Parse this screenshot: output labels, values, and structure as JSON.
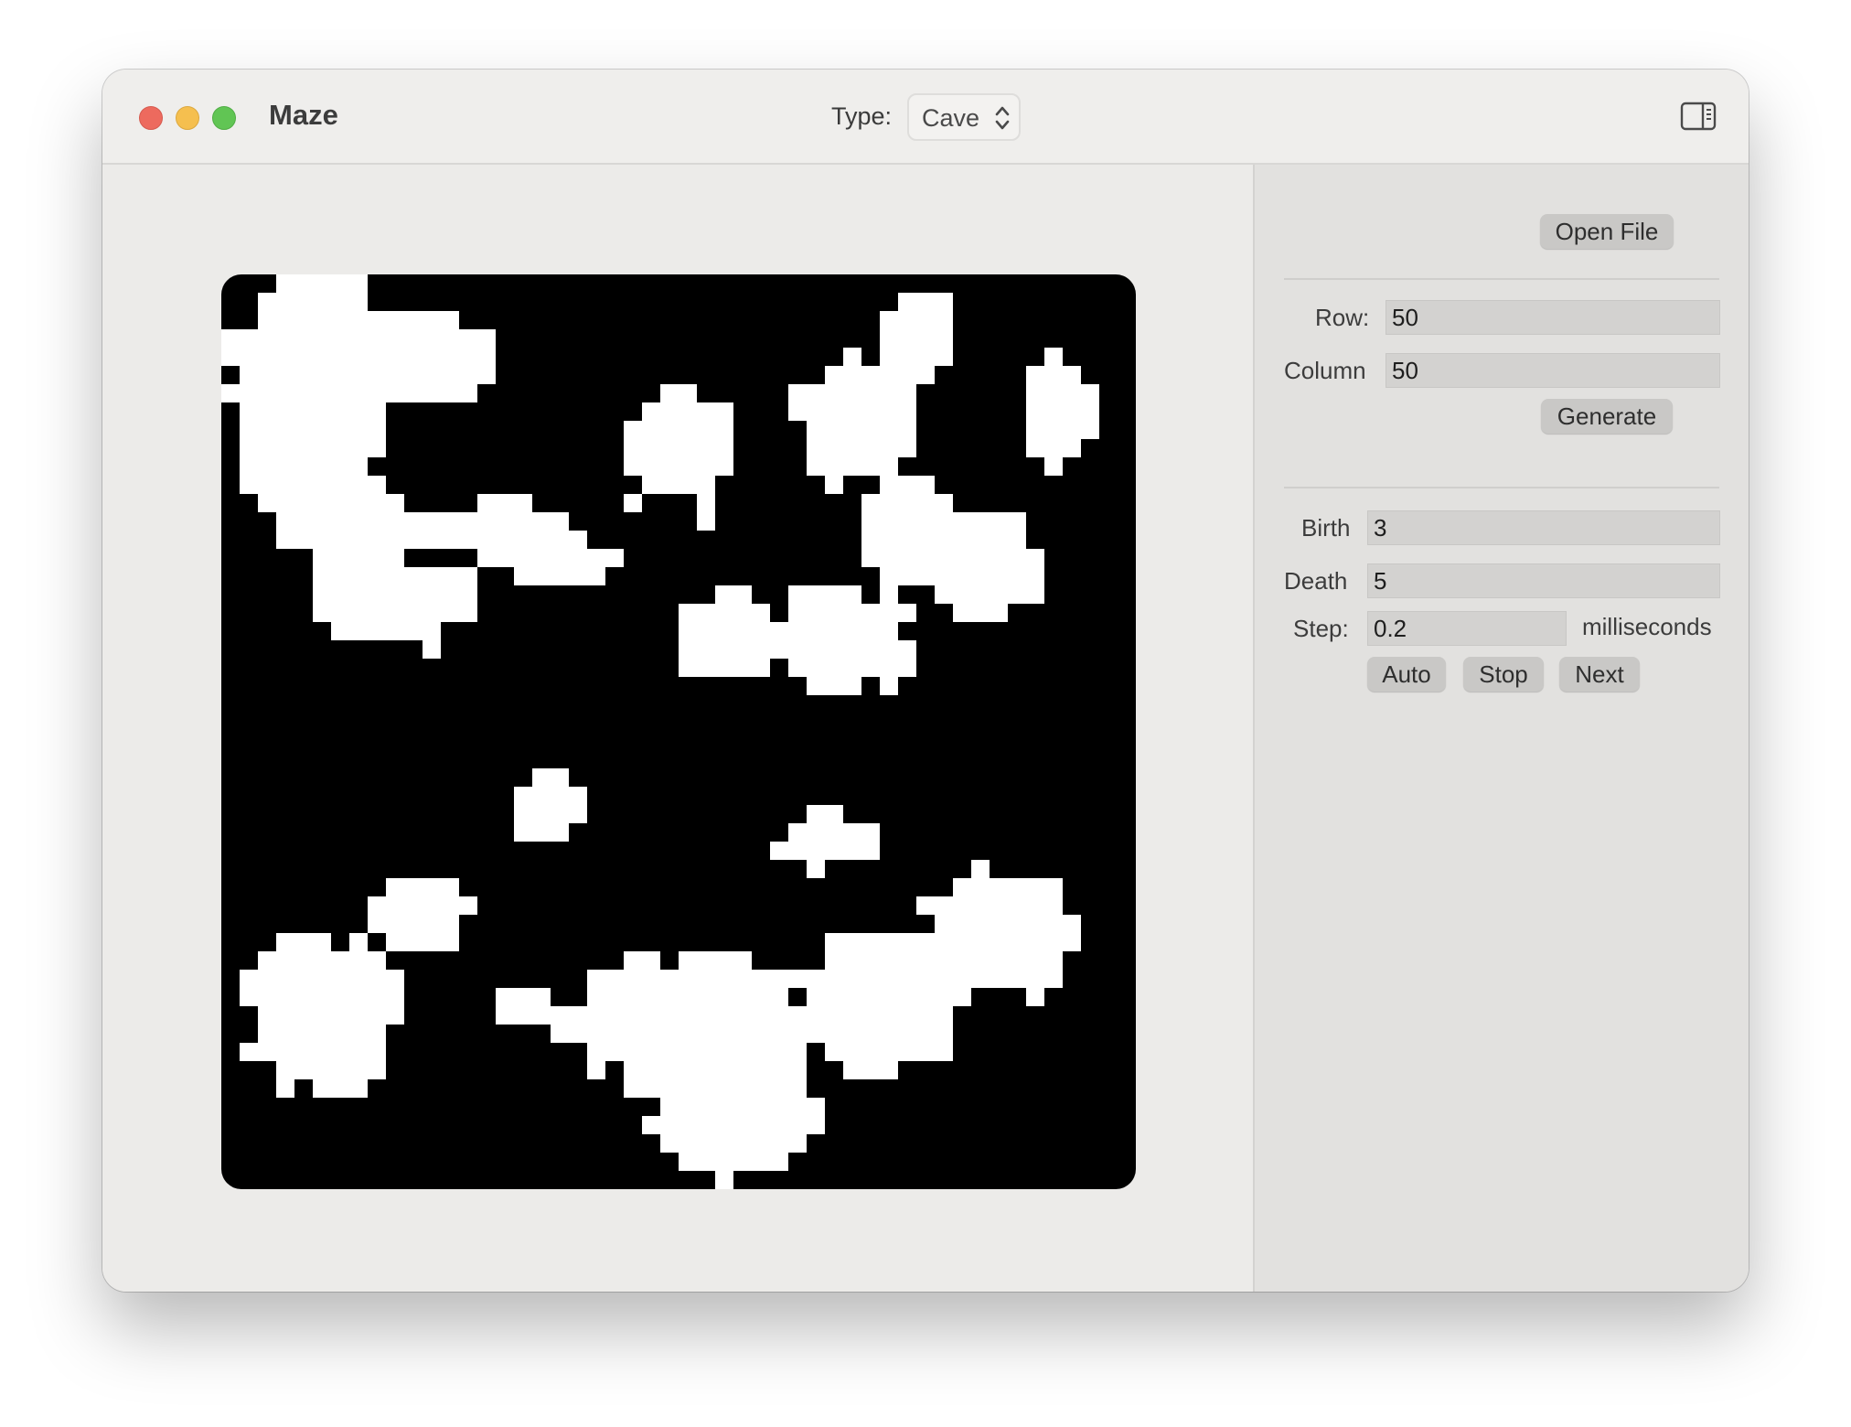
{
  "window": {
    "title": "Maze"
  },
  "toolbar": {
    "type_label": "Type:",
    "type_value": "Cave",
    "icons": {
      "type_select": "up-down-chevron-icon",
      "sidebar": "sidebar-toggle-icon"
    }
  },
  "maze_view": {
    "cell_color": "#ffffff",
    "wall_color": "#000000"
  },
  "inspector": {
    "open_file_label": "Open File",
    "size": {
      "row_label": "Row:",
      "row_value": "50",
      "column_label": "Column",
      "column_value": "50",
      "generate_label": "Generate"
    },
    "cave": {
      "birth_label": "Birth",
      "birth_value": "3",
      "death_label": "Death",
      "death_value": "5",
      "step_label": "Step:",
      "step_value": "0.2",
      "step_unit": "milliseconds",
      "auto_label": "Auto",
      "stop_label": "Stop",
      "next_label": "Next"
    }
  },
  "colors": {
    "close": "#ed6a5e",
    "minimize": "#f5bf4f",
    "maximize": "#61c554"
  }
}
